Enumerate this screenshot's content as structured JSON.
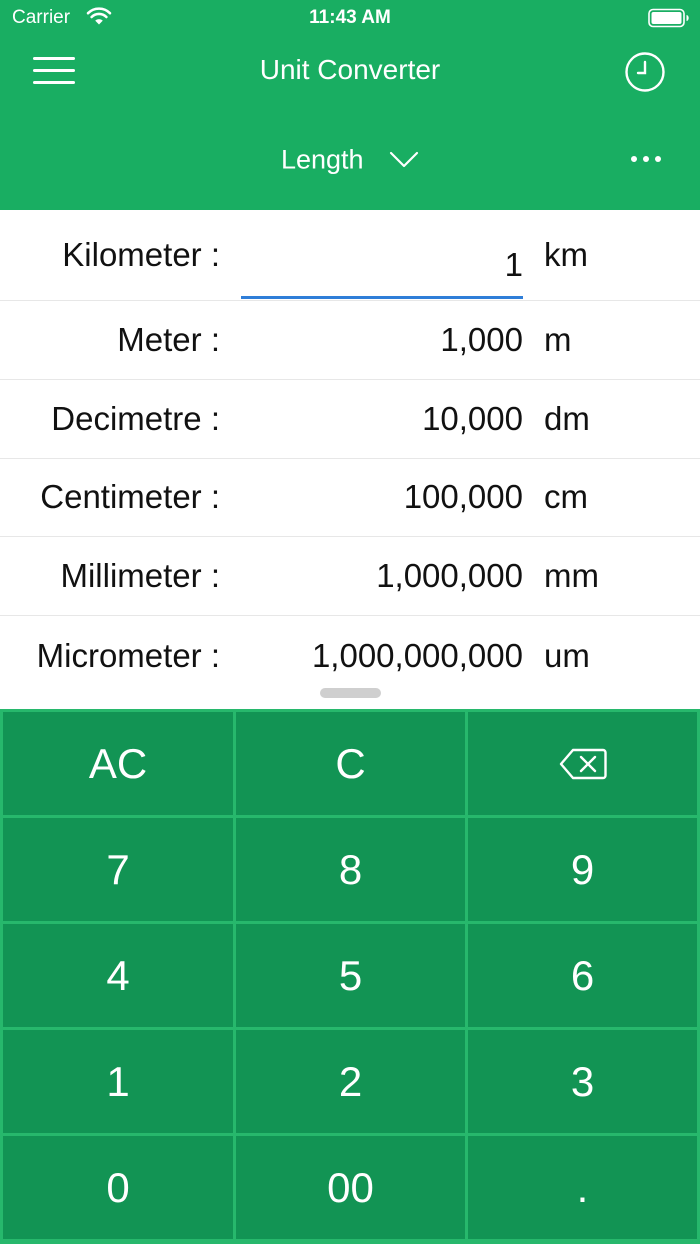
{
  "status_bar": {
    "carrier": "Carrier",
    "time": "11:43 AM"
  },
  "header": {
    "title": "Unit Converter",
    "category": "Length",
    "icons": {
      "menu": "hamburger-menu-icon",
      "history": "clock-icon",
      "dropdown": "chevron-down-icon",
      "more": "more-dots-icon"
    }
  },
  "conversions": [
    {
      "name": "Kilometer :",
      "value": "1",
      "unit": "km"
    },
    {
      "name": "Meter :",
      "value": "1,000",
      "unit": "m"
    },
    {
      "name": "Decimetre :",
      "value": "10,000",
      "unit": "dm"
    },
    {
      "name": "Centimeter :",
      "value": "100,000",
      "unit": "cm"
    },
    {
      "name": "Millimeter :",
      "value": "1,000,000",
      "unit": "mm"
    },
    {
      "name": "Micrometer :",
      "value": "1,000,000,000",
      "unit": "um"
    }
  ],
  "keypad": {
    "ac": "AC",
    "c": "C",
    "backspace_icon": "backspace-icon",
    "k7": "7",
    "k8": "8",
    "k9": "9",
    "k4": "4",
    "k5": "5",
    "k6": "6",
    "k1": "1",
    "k2": "2",
    "k3": "3",
    "k0": "0",
    "k00": "00",
    "dot": "."
  },
  "colors": {
    "primary": "#19ae62",
    "keypad_key": "#129454",
    "keypad_grid": "#27b86c",
    "input_underline": "#2f7ed8"
  }
}
